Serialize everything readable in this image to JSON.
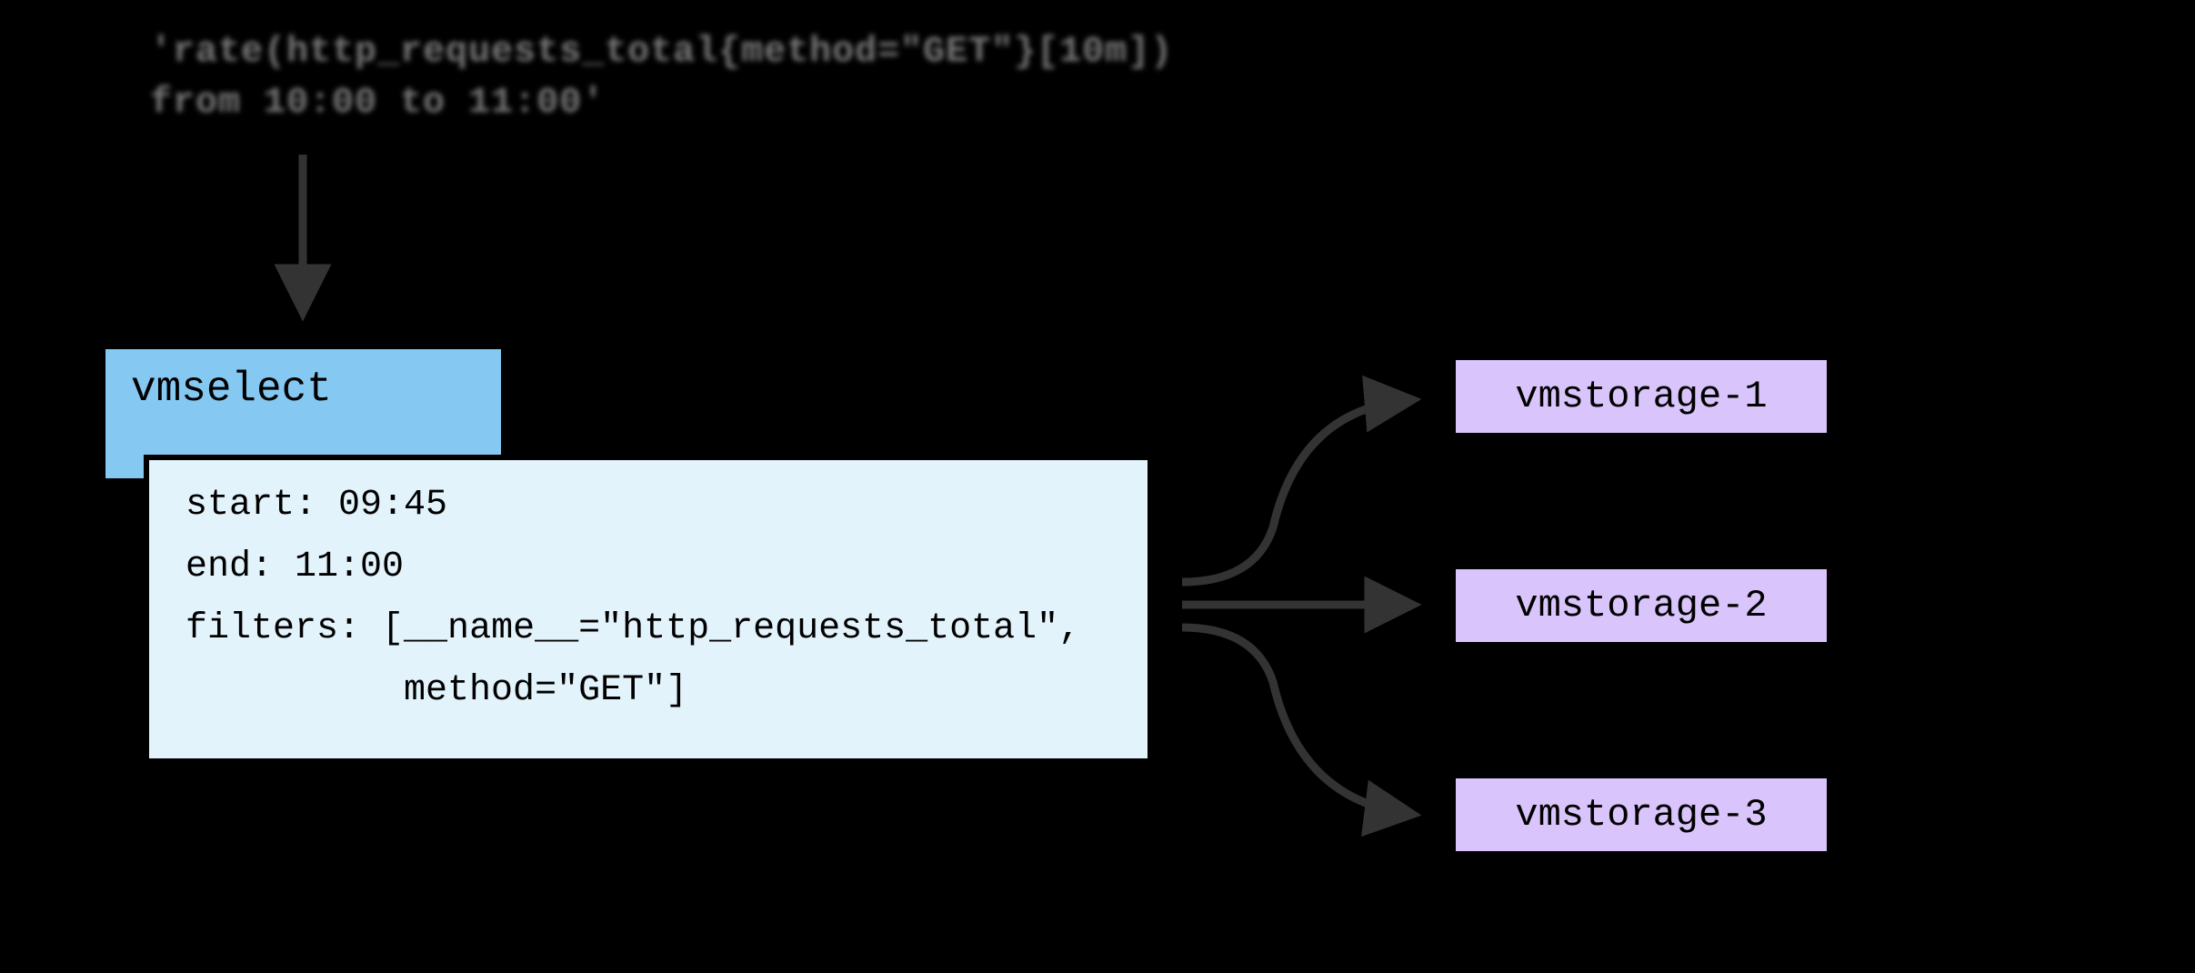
{
  "query": {
    "line1": "'rate(http_requests_total{method=\"GET\"}[10m])",
    "line2": "from 10:00 to 11:00'"
  },
  "vmselect": {
    "label": "vmselect"
  },
  "details": {
    "start_label": "start: ",
    "start_value": "09:45",
    "end_label": "end: ",
    "end_value": "11:00",
    "filters_label": "filters: ",
    "filters_line1": "[__name__=\"http_requests_total\",",
    "filters_line2": "          method=\"GET\"]"
  },
  "vmstorage": {
    "node1": "vmstorage-1",
    "node2": "vmstorage-2",
    "node3": "vmstorage-3"
  }
}
